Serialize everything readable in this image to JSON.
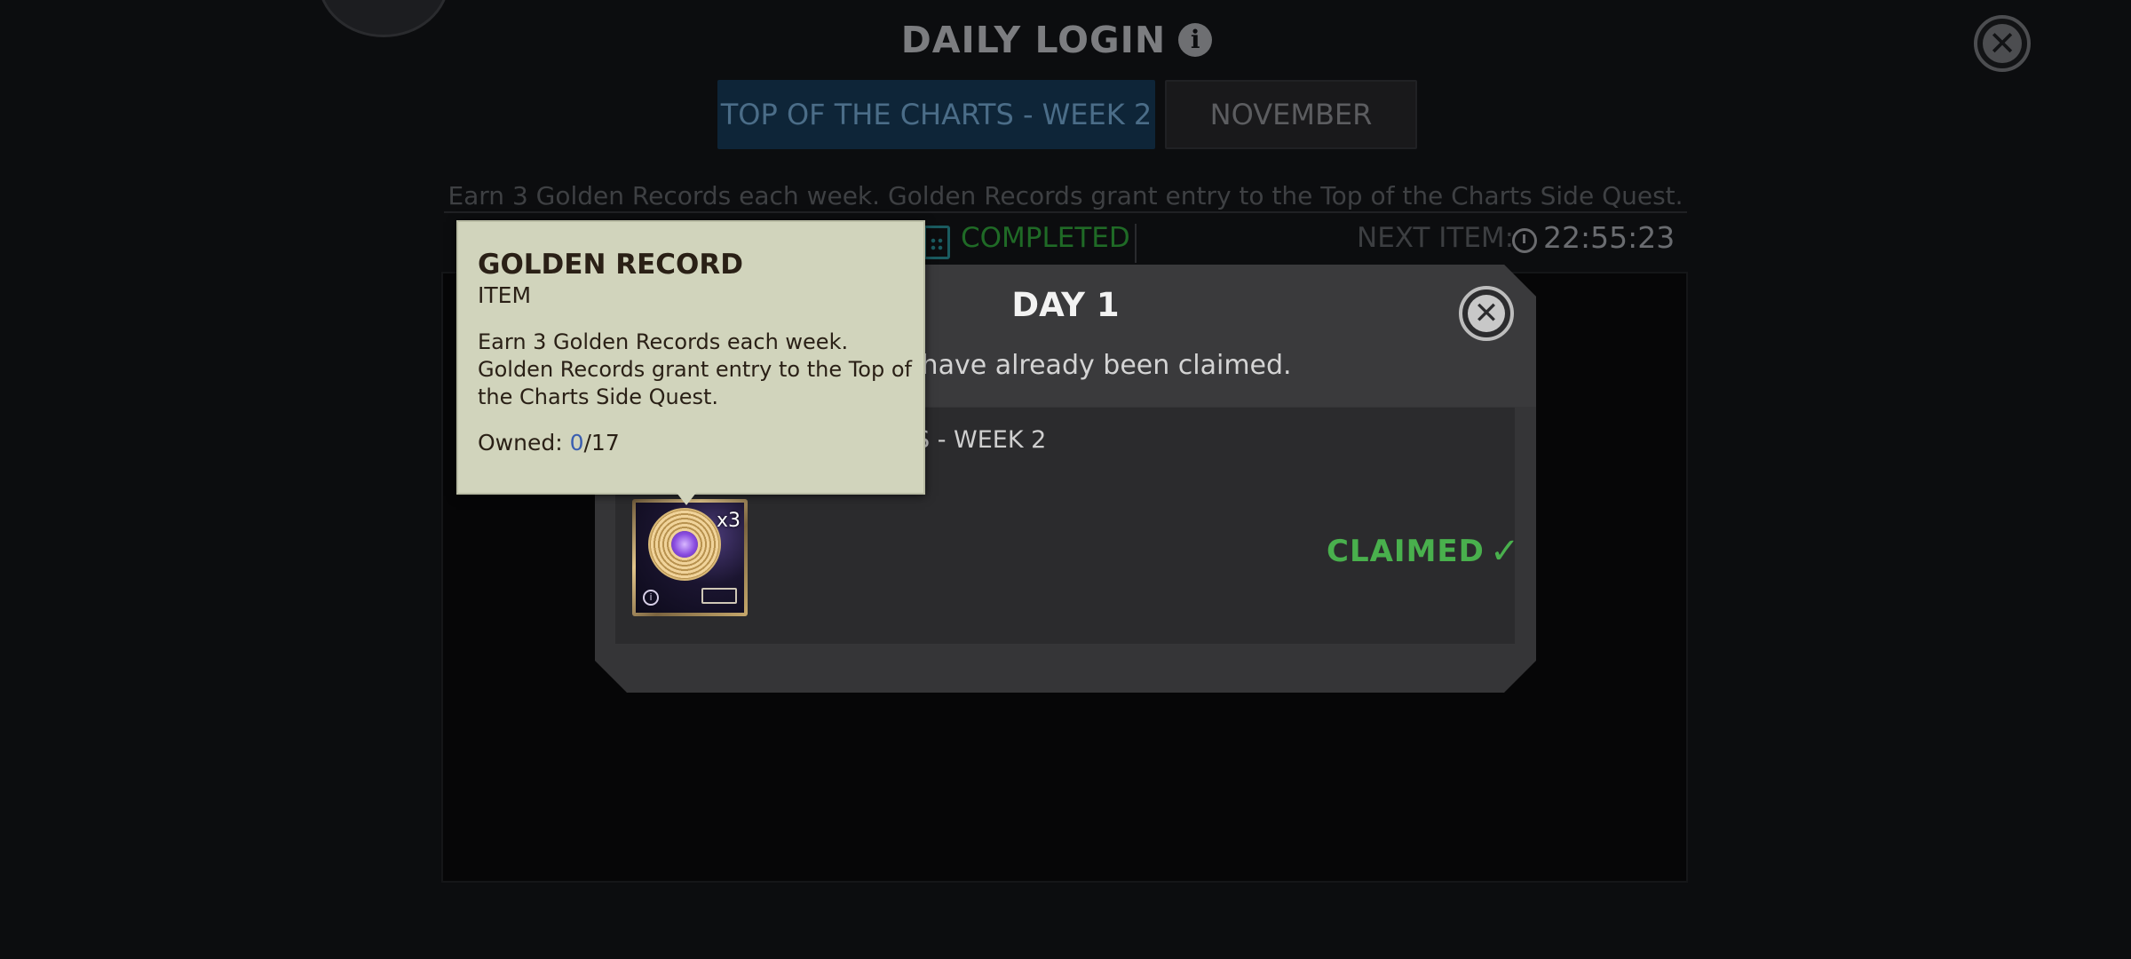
{
  "header": {
    "title": "DAILY LOGIN",
    "info_icon": "info-icon",
    "close_icon": "close-icon"
  },
  "tabs": [
    {
      "label": "TOP OF THE CHARTS - WEEK 2",
      "active": true
    },
    {
      "label": "NOVEMBER",
      "active": false
    }
  ],
  "description": "Earn 3 Golden Records each week. Golden Records grant entry to the Top of the Charts Side Quest.",
  "status": {
    "completed": "COMPLETED",
    "next_item_label": "NEXT ITEM:",
    "timer": "22:55:23"
  },
  "modal": {
    "title": "DAY 1",
    "message": "vards have already been claimed.",
    "reward_title": "S - WEEK 2",
    "item_quantity": "x3",
    "claimed_label": "CLAIMED",
    "check_glyph": "✓"
  },
  "tooltip": {
    "title": "GOLDEN RECORD",
    "type": "ITEM",
    "description": "Earn 3 Golden Records each week. Golden Records grant entry to the Top of the Charts Side Quest.",
    "owned_label": "Owned: ",
    "owned_count": "0",
    "owned_total": "/17"
  },
  "colors": {
    "accent_green": "#49b04d",
    "tooltip_bg": "#d1d4bc",
    "active_tab": "#0e2538"
  }
}
